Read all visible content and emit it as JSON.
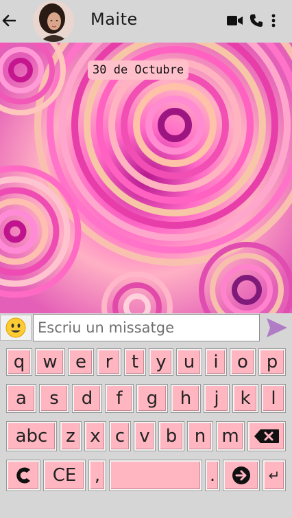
{
  "header": {
    "contact_name": "Maite"
  },
  "chat": {
    "date_label": "30 de Octubre"
  },
  "input": {
    "placeholder": "Escriu un missatge"
  },
  "keyboard": {
    "row1": [
      "q",
      "w",
      "e",
      "r",
      "t",
      "y",
      "u",
      "i",
      "o",
      "p"
    ],
    "row2": [
      "a",
      "s",
      "d",
      "f",
      "g",
      "h",
      "j",
      "k",
      "l"
    ],
    "row3_letters": [
      "z",
      "x",
      "c",
      "v",
      "b",
      "n",
      "m"
    ],
    "shift_label": "abc",
    "ce_label": "CE",
    "comma_label": ",",
    "period_label": ".",
    "enter_label": "↵"
  },
  "icons": {
    "back": "arrow-left-icon",
    "video": "video-camera-icon",
    "call": "phone-icon",
    "menu": "more-vert-icon",
    "emoji": "emoji-face-icon",
    "send": "send-arrow-icon",
    "backspace": "backspace-icon",
    "clear": "c-clear-icon",
    "next": "arrow-right-circle-icon"
  },
  "colors": {
    "key_fill": "#ffb6c1",
    "chip_fill": "#ffc0cb",
    "send": "#b07cc6",
    "header_bg": "#d6d6d6"
  }
}
